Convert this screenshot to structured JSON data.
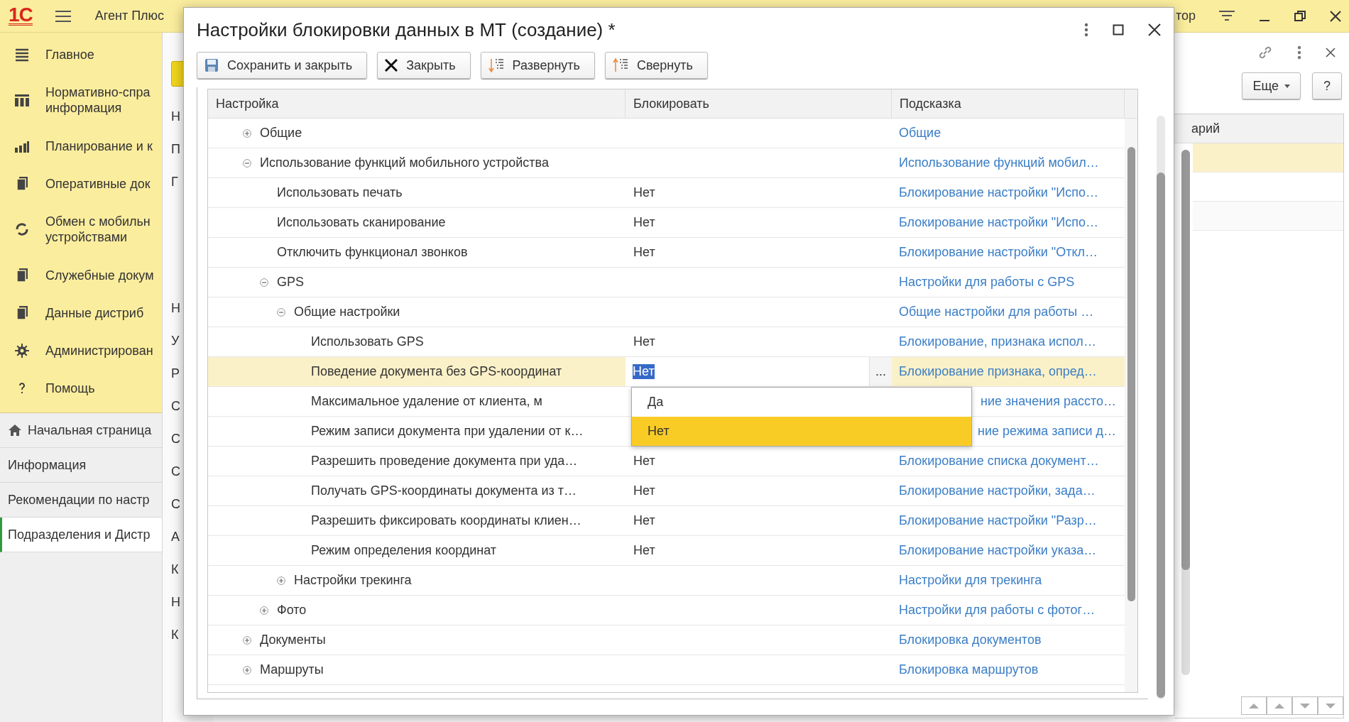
{
  "app": {
    "logo": "1С",
    "title": "Агент Плюс",
    "title_right": "тор"
  },
  "sidebar": {
    "sections": [
      {
        "lines": [
          "Главное"
        ]
      },
      {
        "lines": [
          "Нормативно-спра",
          "информация"
        ]
      },
      {
        "lines": [
          "Планирование и к"
        ]
      },
      {
        "lines": [
          "Оперативные док"
        ]
      },
      {
        "lines": [
          "Обмен с мобильн",
          "устройствами"
        ]
      },
      {
        "lines": [
          "Служебные докум"
        ]
      },
      {
        "lines": [
          "Данные дистриб"
        ]
      },
      {
        "lines": [
          "Администрирован"
        ]
      },
      {
        "lines": [
          "Помощь"
        ]
      }
    ],
    "open_pages": [
      {
        "label": "Начальная страница",
        "selected": false
      },
      {
        "label": "Информация",
        "selected": false
      },
      {
        "label": "Рекомендации по настр",
        "selected": false
      },
      {
        "label": "Подразделения и Дистр",
        "selected": true
      }
    ]
  },
  "background_form": {
    "labels_top": [
      "Н",
      "П",
      "Г"
    ],
    "labels_bottom": [
      "Н",
      "У",
      "Р",
      "С",
      "С",
      "С",
      "С",
      "А",
      "К",
      "Н",
      "К"
    ]
  },
  "right_panel": {
    "buttons": [
      "Еще",
      "?"
    ],
    "column_header": "арий"
  },
  "dialog": {
    "title": "Настройки блокировки данных в МТ (создание) *",
    "toolbar": [
      "Сохранить и закрыть",
      "Закрыть",
      "Развернуть",
      "Свернуть"
    ]
  },
  "table": {
    "columns": [
      "Настройка",
      "Блокировать",
      "Подсказка"
    ],
    "choice_button": "...",
    "dropdown": {
      "open": true,
      "options": [
        {
          "label": "Да",
          "selected": false
        },
        {
          "label": "Нет",
          "selected": true
        }
      ]
    },
    "rows": [
      {
        "name": "Общие",
        "hint": "Общие",
        "expanded": false,
        "selected": false
      },
      {
        "name": "Использование функций мобильного устройства",
        "hint": "Использование функций мобил…",
        "expanded": true,
        "selected": false,
        "children": [
          {
            "name": "Использовать печать",
            "value": "Нет",
            "hint": "Блокирование настройки \"Испо…",
            "selected": false
          },
          {
            "name": "Использовать сканирование",
            "value": "Нет",
            "hint": "Блокирование настройки \"Испо…",
            "selected": false
          },
          {
            "name": "Отключить функционал звонков",
            "value": "Нет",
            "hint": "Блокирование настройки \"Откл…",
            "selected": false
          },
          {
            "name": "GPS",
            "hint": "Настройки для работы с GPS",
            "expanded": true,
            "selected": false,
            "children": [
              {
                "name": "Общие настройки",
                "hint": "Общие настройки для работы …",
                "expanded": true,
                "selected": false,
                "children": [
                  {
                    "name": "Использовать GPS",
                    "value": "Нет",
                    "hint": "Блокирование, признака испол…",
                    "selected": false
                  },
                  {
                    "name": "Поведение документа без GPS-координат",
                    "value": "Нет",
                    "hint": "Блокирование признака, опред…",
                    "selected": true
                  },
                  {
                    "name": "Максимальное удаление от клиента, м",
                    "hint": "ние значения рассто…",
                    "hint_covered": true,
                    "selected": false
                  },
                  {
                    "name": "Режим записи документа при удалении от к…",
                    "hint": "ние режима записи д…",
                    "hint_covered": true,
                    "selected": false
                  },
                  {
                    "name": "Разрешить проведение документа при уда…",
                    "value": "Нет",
                    "hint": "Блокирование списка документ…",
                    "selected": false
                  },
                  {
                    "name": "Получать GPS-координаты документа из т…",
                    "value": "Нет",
                    "hint": "Блокирование настройки, зада…",
                    "selected": false
                  },
                  {
                    "name": "Разрешить фиксировать координаты клиен…",
                    "value": "Нет",
                    "hint": "Блокирование настройки \"Разр…",
                    "selected": false
                  },
                  {
                    "name": "Режим определения координат",
                    "value": "Нет",
                    "hint": "Блокирование настройки указа…",
                    "selected": false
                  }
                ]
              },
              {
                "name": "Настройки трекинга",
                "hint": "Настройки для трекинга",
                "expanded": false,
                "selected": false
              }
            ]
          },
          {
            "name": "Фото",
            "hint": "Настройки для работы с фотог…",
            "expanded": false,
            "selected": false
          }
        ]
      },
      {
        "name": "Документы",
        "hint": "Блокировка документов",
        "expanded": false,
        "selected": false
      },
      {
        "name": "Маршруты",
        "hint": "Блокировка маршрутов",
        "expanded": false,
        "selected": false
      }
    ]
  }
}
